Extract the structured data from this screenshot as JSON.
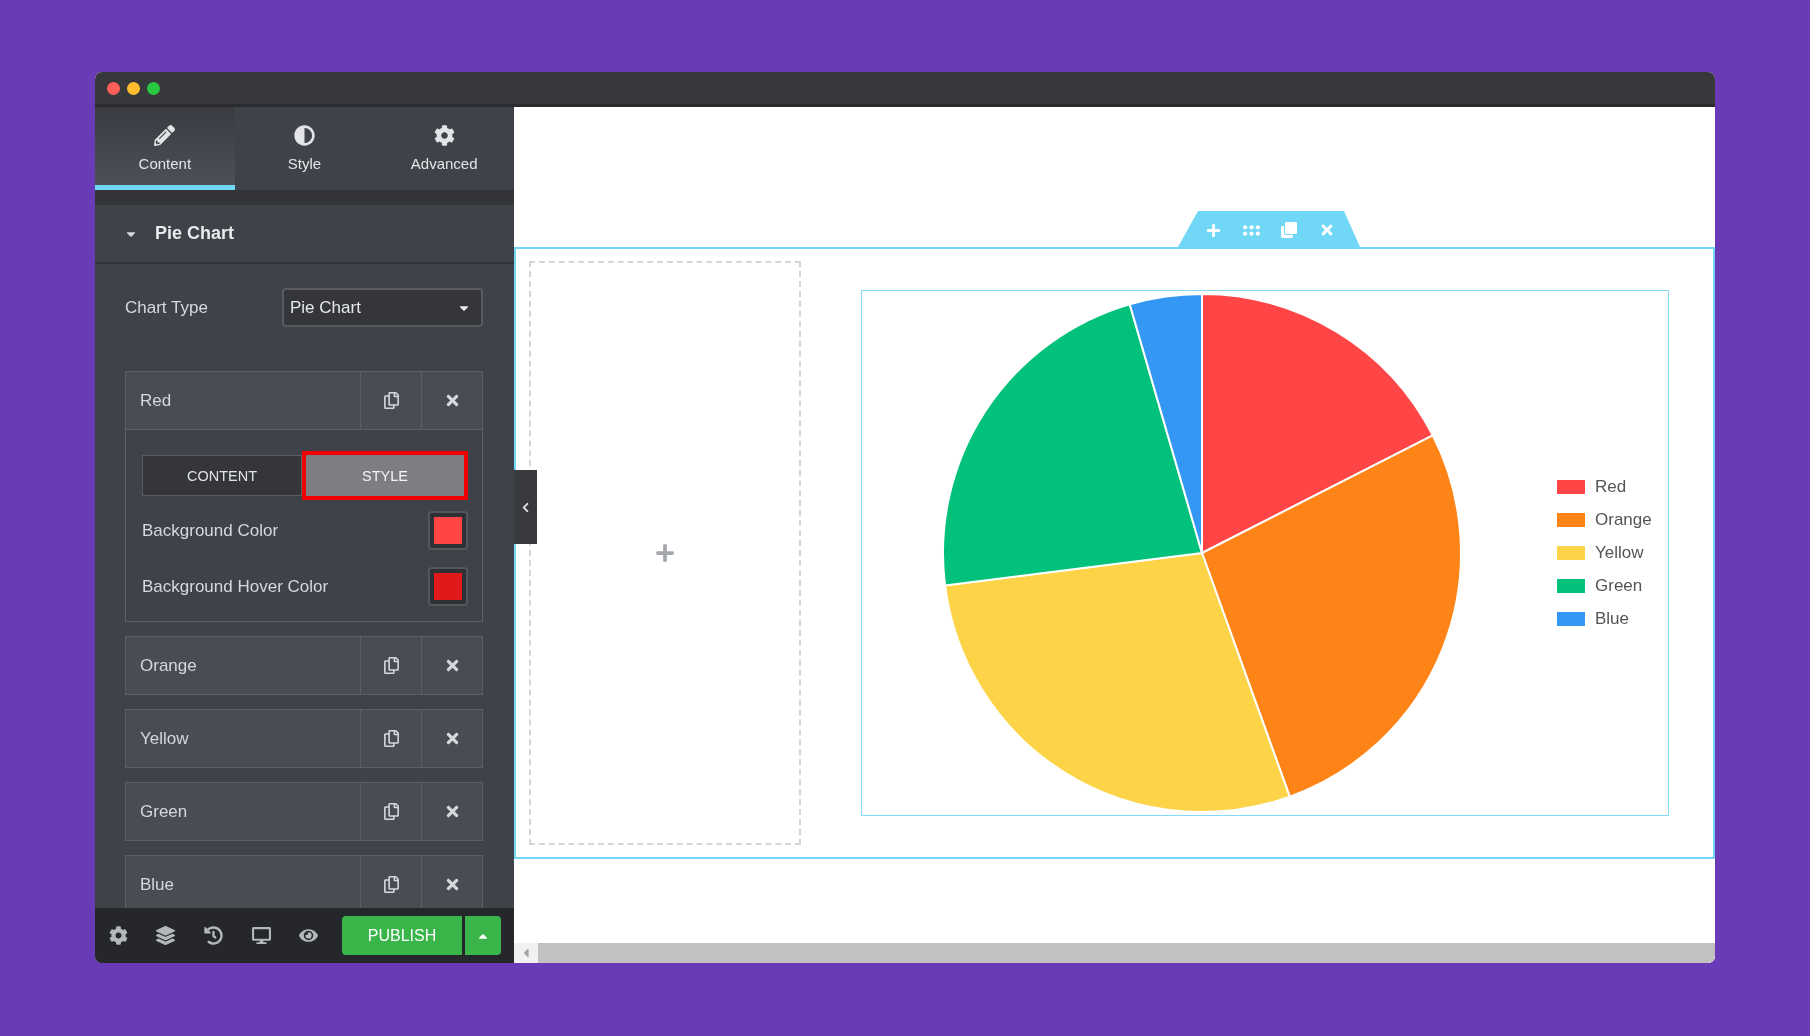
{
  "panel": {
    "tabs": [
      {
        "label": "Content",
        "selected": true
      },
      {
        "label": "Style",
        "selected": false
      },
      {
        "label": "Advanced",
        "selected": false
      }
    ],
    "section": {
      "title": "Pie Chart",
      "expanded": true
    },
    "chart_type": {
      "label": "Chart Type",
      "value": "Pie Chart"
    },
    "items": [
      {
        "label": "Red",
        "expanded": true,
        "tabs": [
          {
            "label": "CONTENT",
            "selected": false,
            "highlighted": false
          },
          {
            "label": "STYLE",
            "selected": true,
            "highlighted": true
          }
        ],
        "fields": [
          {
            "label": "Background Color",
            "color": "#ff4545"
          },
          {
            "label": "Background Hover Color",
            "color": "#e01a1a"
          }
        ]
      },
      {
        "label": "Orange",
        "expanded": false
      },
      {
        "label": "Yellow",
        "expanded": false
      },
      {
        "label": "Green",
        "expanded": false
      },
      {
        "label": "Blue",
        "expanded": false
      }
    ],
    "publish_button": {
      "label": "PUBLISH"
    }
  },
  "canvas": {
    "chart": {
      "chart_data": {
        "type": "pie",
        "categories": [
          "Red",
          "Orange",
          "Yellow",
          "Green",
          "Blue"
        ],
        "values": [
          17.5,
          27,
          28.5,
          22.5,
          4.5
        ],
        "colors": [
          "#ff4545",
          "#ff8417",
          "#fdd448",
          "#02c27b",
          "#3497f3"
        ],
        "legend": "right"
      }
    }
  }
}
